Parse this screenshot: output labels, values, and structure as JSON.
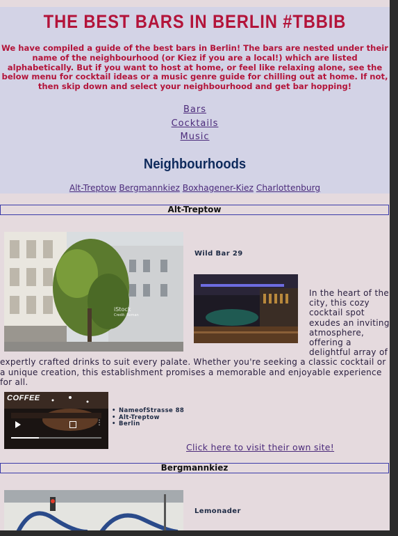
{
  "header": {
    "title": "THE BEST BARS IN BERLIN #TBBIB",
    "intro": "We have compiled a guide of the best bars in Berlin! The bars are nested under their name of the neighbourhood (or Kiez if you are a local!) which are listed alphabetically. But if you want to host at home, or feel like relaxing alone, see the below menu for cocktail ideas or a music genre guide for chilling out at home. If not, then skip down and select your neighbourhood and get bar hopping!"
  },
  "menu": [
    "Bars",
    "Cocktails",
    "Music"
  ],
  "neighbourhoods": {
    "title": "Neighbourhoods",
    "links": [
      "Alt-Treptow",
      "Bergmannkiez",
      "Boxhagener-Kiez",
      "Charlottenburg"
    ]
  },
  "sections": [
    {
      "heading": "Alt-Treptow",
      "bar_name": "Wild Bar 29",
      "description": "In the heart of the city, this cozy cocktail spot exudes an inviting atmosphere, offering a delightful array of expertly crafted drinks to suit every palate. Whether you're seeking a classic cocktail or a unique creation, this establishment promises a memorable and enjoyable experience for all.",
      "address": [
        "NameofStrasse 88",
        "Alt-Treptow",
        "Berlin"
      ],
      "visit_link": "Click here to visit their own site!",
      "watermark": "iStock",
      "watermark_sub": "Credit: Roman"
    },
    {
      "heading": "Bergmannkiez",
      "bar_name": "Lemonader"
    }
  ],
  "video": {
    "overlay_text": "COFFEE"
  },
  "colors": {
    "accent": "#b3143a",
    "link": "#4b2a7a",
    "hero_bg": "#d3d3e6",
    "page_bg": "#e5dade"
  }
}
